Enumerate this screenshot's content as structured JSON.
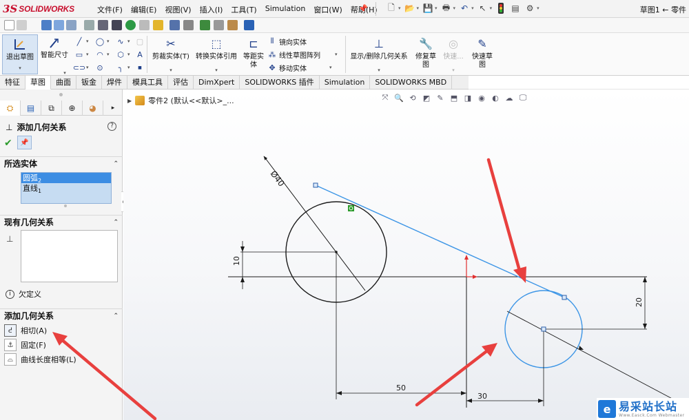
{
  "app": {
    "logo_ds": "3S",
    "logo_text": "SOLIDWORKS",
    "menus": [
      "文件(F)",
      "编辑(E)",
      "视图(V)",
      "插入(I)",
      "工具(T)",
      "Simulation",
      "窗口(W)",
      "帮助(H)"
    ],
    "document_title": "草图1 ← 零件"
  },
  "ribbon": {
    "exit_sketch": "退出草图",
    "smart_dimension": "智能尺寸",
    "trim_entities": "剪裁实体(T)",
    "convert_entities": "转换实体引用",
    "offset_entities": "等距实\n体",
    "mirror_entities": "镜向实体",
    "linear_pattern": "线性草图阵列",
    "move_entities": "移动实体",
    "display_delete_relations": "显示/删除几何关系",
    "repair_sketch": "修复草\n图",
    "quick_snaps_disabled": "快速...",
    "quick_sketch": "快速草\n图"
  },
  "tabs": [
    {
      "label": "特征",
      "active": false
    },
    {
      "label": "草图",
      "active": true
    },
    {
      "label": "曲面",
      "active": false
    },
    {
      "label": "钣金",
      "active": false
    },
    {
      "label": "焊件",
      "active": false
    },
    {
      "label": "模具工具",
      "active": false
    },
    {
      "label": "评估",
      "active": false
    },
    {
      "label": "DimXpert",
      "active": false
    },
    {
      "label": "SOLIDWORKS 插件",
      "active": false
    },
    {
      "label": "Simulation",
      "active": false
    },
    {
      "label": "SOLIDWORKS MBD",
      "active": false
    }
  ],
  "property_manager": {
    "title": "添加几何关系",
    "help": "?",
    "selected_entities": {
      "heading": "所选实体",
      "items": [
        {
          "label": "圆弧",
          "sub": "2",
          "selected": true
        },
        {
          "label": "直线",
          "sub": "1",
          "selected": false
        }
      ]
    },
    "existing_relations": {
      "heading": "现有几何关系"
    },
    "status": "欠定义",
    "add_relations": {
      "heading": "添加几何关系",
      "items": [
        {
          "label": "相切(A)",
          "icon": "tangent-icon"
        },
        {
          "label": "固定(F)",
          "icon": "fix-icon"
        },
        {
          "label": "曲线长度相等(L)",
          "icon": "equal-curve-length-icon"
        }
      ]
    }
  },
  "graphics": {
    "tree_crumb": "零件2 (默认<<默认>_...",
    "dimensions": {
      "diameter": "Ø40",
      "vertical_left": "10",
      "vertical_right": "20",
      "horizontal_bottom": "50",
      "horizontal_small": "30"
    },
    "colors": {
      "sketch_line": "#1a1a1a",
      "selected": "#3c95e6",
      "axis_red": "#e03030",
      "annotation_arrow": "#e8403e",
      "relation_green": "#2a9a2a"
    }
  },
  "watermark": {
    "cn": "易采站长站",
    "en": "Www.Easck.Com Webmaster"
  }
}
